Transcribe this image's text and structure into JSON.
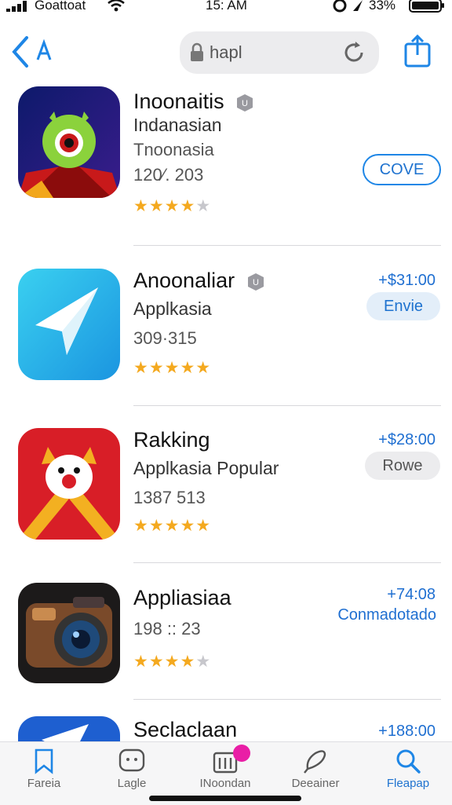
{
  "status_bar": {
    "carrier": "Goattoat",
    "time": "15: AM",
    "battery_pct": "33%"
  },
  "nav": {
    "search_text": "hapl",
    "back_icon": "chevron-back-icon",
    "share_icon": "share-icon"
  },
  "apps": [
    {
      "title": "Inoonaitis",
      "subtitle": "Indanasian",
      "subtitle2": "Tnoonasia",
      "meta": "120⁄. 203",
      "rating": 4.5,
      "action": "COVE"
    },
    {
      "title": "Anoonaliar",
      "subtitle": "Applkasia",
      "meta": "309·315",
      "rating": 5,
      "price": "+$31:00",
      "action": "Envie"
    },
    {
      "title": "Rakking",
      "subtitle": "Applkasia Popular",
      "meta": "1387 513",
      "rating": 5,
      "price": "+$28:00",
      "action": "Rowe"
    },
    {
      "title": "Appliasiaa",
      "meta": "198 :: 23",
      "rating": 4.5,
      "price": "+74:08",
      "action": "Conmadotado"
    },
    {
      "title": "Seclaclaan",
      "price": "+188:00"
    }
  ],
  "tabs": [
    {
      "label": "Fareia",
      "icon": "bookmark-icon"
    },
    {
      "label": "Lagle",
      "icon": "chat-icon"
    },
    {
      "label": "INoondan",
      "icon": "store-icon"
    },
    {
      "label": "Deeainer",
      "icon": "pen-icon"
    },
    {
      "label": "Fleapap",
      "icon": "search-icon"
    }
  ],
  "colors": {
    "accent": "#1e72cf",
    "star": "#f4a91f",
    "notification_dot": "#e91ea6"
  }
}
